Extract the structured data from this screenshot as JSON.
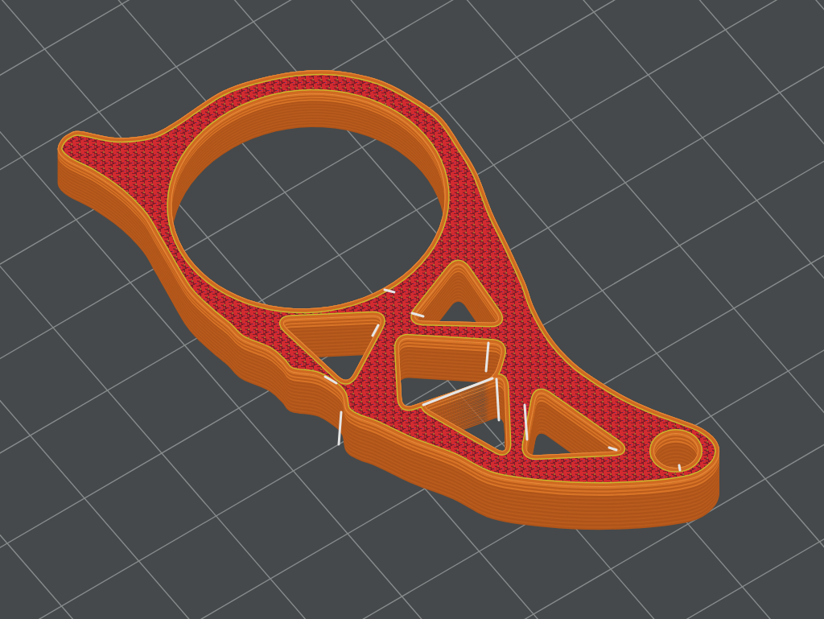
{
  "plate": {
    "kind": "grid"
  },
  "part": {
    "kind": "sliced-model",
    "seams": true
  }
}
